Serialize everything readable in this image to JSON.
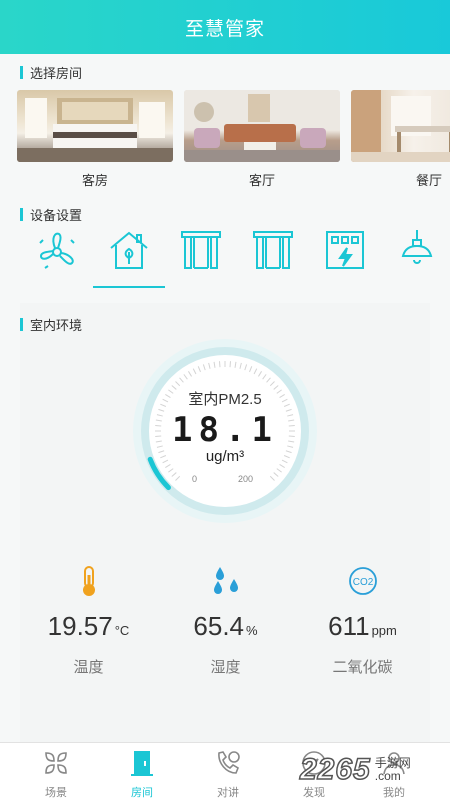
{
  "header": {
    "title": "至慧管家"
  },
  "sections": {
    "rooms_title": "选择房间",
    "devices_title": "设备设置",
    "env_title": "室内环境"
  },
  "rooms": [
    {
      "label": "客房",
      "active": false
    },
    {
      "label": "客厅",
      "active": true
    },
    {
      "label": "餐厅",
      "active": false
    }
  ],
  "devices": [
    {
      "icon": "fan-icon",
      "active": false
    },
    {
      "icon": "home-icon",
      "active": true
    },
    {
      "icon": "curtain-icon",
      "active": false
    },
    {
      "icon": "curtain-icon",
      "active": false
    },
    {
      "icon": "power-box-icon",
      "active": false
    },
    {
      "icon": "ceiling-lamp-icon",
      "active": false
    }
  ],
  "gauge": {
    "label": "室内PM2.5",
    "value": "18.1",
    "unit": "ug/m³",
    "min": "0",
    "max": "200",
    "level": 0.09
  },
  "metrics": [
    {
      "icon": "thermometer-icon",
      "value": "19.57",
      "unit": "°C",
      "name": "温度"
    },
    {
      "icon": "water-drops-icon",
      "value": "65.4",
      "unit": "%",
      "name": "湿度"
    },
    {
      "icon": "co2-icon",
      "icon_text": "CO2",
      "value": "611",
      "unit": "ppm",
      "name": "二氧化碳"
    }
  ],
  "tabs": [
    {
      "label": "场景",
      "icon": "scene-grid-icon",
      "active": false
    },
    {
      "label": "房间",
      "icon": "door-icon",
      "active": true
    },
    {
      "label": "对讲",
      "icon": "intercom-icon",
      "active": false
    },
    {
      "label": "发现",
      "icon": "compass-icon",
      "active": false
    },
    {
      "label": "我的",
      "icon": "profile-icon",
      "active": false
    }
  ],
  "watermark": {
    "number": "2265",
    "site_line1": "手游网",
    "site_line2": ".com"
  },
  "colors": {
    "accent": "#1bc6d4",
    "header_start": "#2ad6c9",
    "header_end": "#19c9d9"
  }
}
